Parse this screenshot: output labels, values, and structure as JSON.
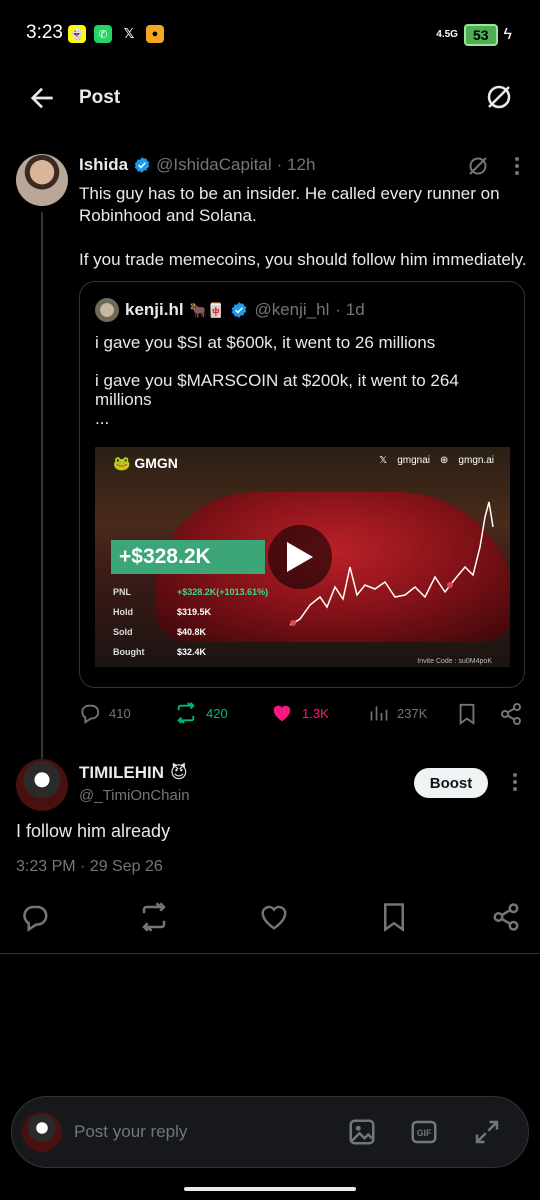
{
  "status_bar": {
    "time": "3:23",
    "network": "4.5G",
    "battery": "53",
    "apps": [
      "snapchat-icon",
      "whatsapp-icon",
      "x-icon",
      "app-icon"
    ]
  },
  "header": {
    "title": "Post"
  },
  "post": {
    "name": "Ishida",
    "handle": "@IshidaCapital",
    "time": "· 12h",
    "text_1": "This guy has to be an insider. He called every runner on Robinhood and Solana.",
    "text_2": "If you trade memecoins, you should follow him immediately.",
    "quote": {
      "name": "kenji.hl",
      "emoji": "🐂🀄",
      "handle": "@kenji_hl",
      "time": "· 1d",
      "line_1": "i gave you $SI at $600k, it went to 26 millions",
      "line_2": "i gave you $MARSCOIN at $200k, it went to 264 millions",
      "line_3": "...",
      "media": {
        "brand": "GMGN",
        "top_right_1": "gmgnai",
        "top_right_2": "gmgn.ai",
        "pnl_badge": "+$328.2K",
        "stats": [
          {
            "k": "PNL",
            "v": "+$328.2K(+1013.61%)"
          },
          {
            "k": "Hold",
            "v": "$319.5K"
          },
          {
            "k": "Sold",
            "v": "$40.8K"
          },
          {
            "k": "Bought",
            "v": "$32.4K"
          }
        ],
        "invite": "Invite Code : su0M4poK"
      }
    },
    "actions": {
      "replies": "410",
      "reposts": "420",
      "likes": "1.3K",
      "views": "237K"
    }
  },
  "reply": {
    "name": "TIMILEHIN",
    "emoji": "😈",
    "handle": "@_TimiOnChain",
    "boost_label": "Boost",
    "text": "I follow him already",
    "timestamp": "3:23 PM · 29 Sep 26"
  },
  "composer": {
    "placeholder": "Post your reply"
  },
  "colors": {
    "background": "#000000",
    "accent": "#1d9bf0",
    "repost_green": "#00ba7c",
    "like_pink": "#f91880"
  }
}
